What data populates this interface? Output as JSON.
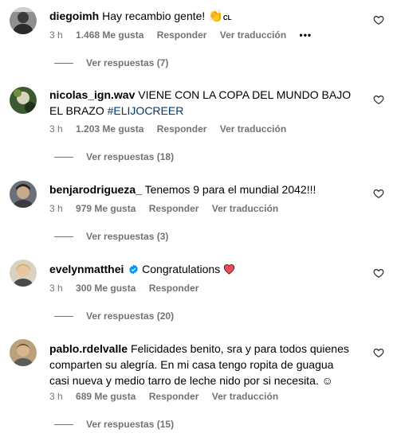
{
  "comments": [
    {
      "username": "diegoimh",
      "text": "Hay recambio gente! ",
      "emoji": "👏",
      "emoji_suffix": "CL",
      "time": "3 h",
      "likes": "1.468 Me gusta",
      "reply": "Responder",
      "translate": "Ver traducción",
      "more": "•••",
      "replies": "Ver respuestas (7)"
    },
    {
      "username": "nicolas_ign.wav",
      "text": "VIENE CON LA COPA DEL MUNDO BAJO EL BRAZO ",
      "hashtag": "#ELIJOCREER",
      "time": "3 h",
      "likes": "1.203 Me gusta",
      "reply": "Responder",
      "translate": "Ver traducción",
      "replies": "Ver respuestas (18)"
    },
    {
      "username": "benjarodrigueza_",
      "text": "Tenemos 9 para el mundial 2042!!!",
      "time": "3 h",
      "likes": "979 Me gusta",
      "reply": "Responder",
      "translate": "Ver traducción",
      "replies": "Ver respuestas (3)"
    },
    {
      "username": "evelynmatthei",
      "text": "Congratulations ",
      "time": "3 h",
      "likes": "300 Me gusta",
      "reply": "Responder",
      "replies": "Ver respuestas (20)"
    },
    {
      "username": "pablo.rdelvalle",
      "text": "Felicidades benito, sra y para todos quienes comparten su alegría. En mi casa tengo ropita de guagua casi nueva y medio tarro de leche nido por si necesita. ☺",
      "time": "3 h",
      "likes": "689 Me gusta",
      "reply": "Responder",
      "translate": "Ver traducción",
      "replies": "Ver respuestas (15)"
    }
  ],
  "colors": {
    "meta": "#737373",
    "hashtag": "#00376b",
    "verified": "#0095f6",
    "heart": "#ed4956"
  },
  "icons": [
    "heart-outline-icon",
    "verified-badge-icon",
    "clap-emoji",
    "red-heart-emoji",
    "smile-emoji"
  ]
}
